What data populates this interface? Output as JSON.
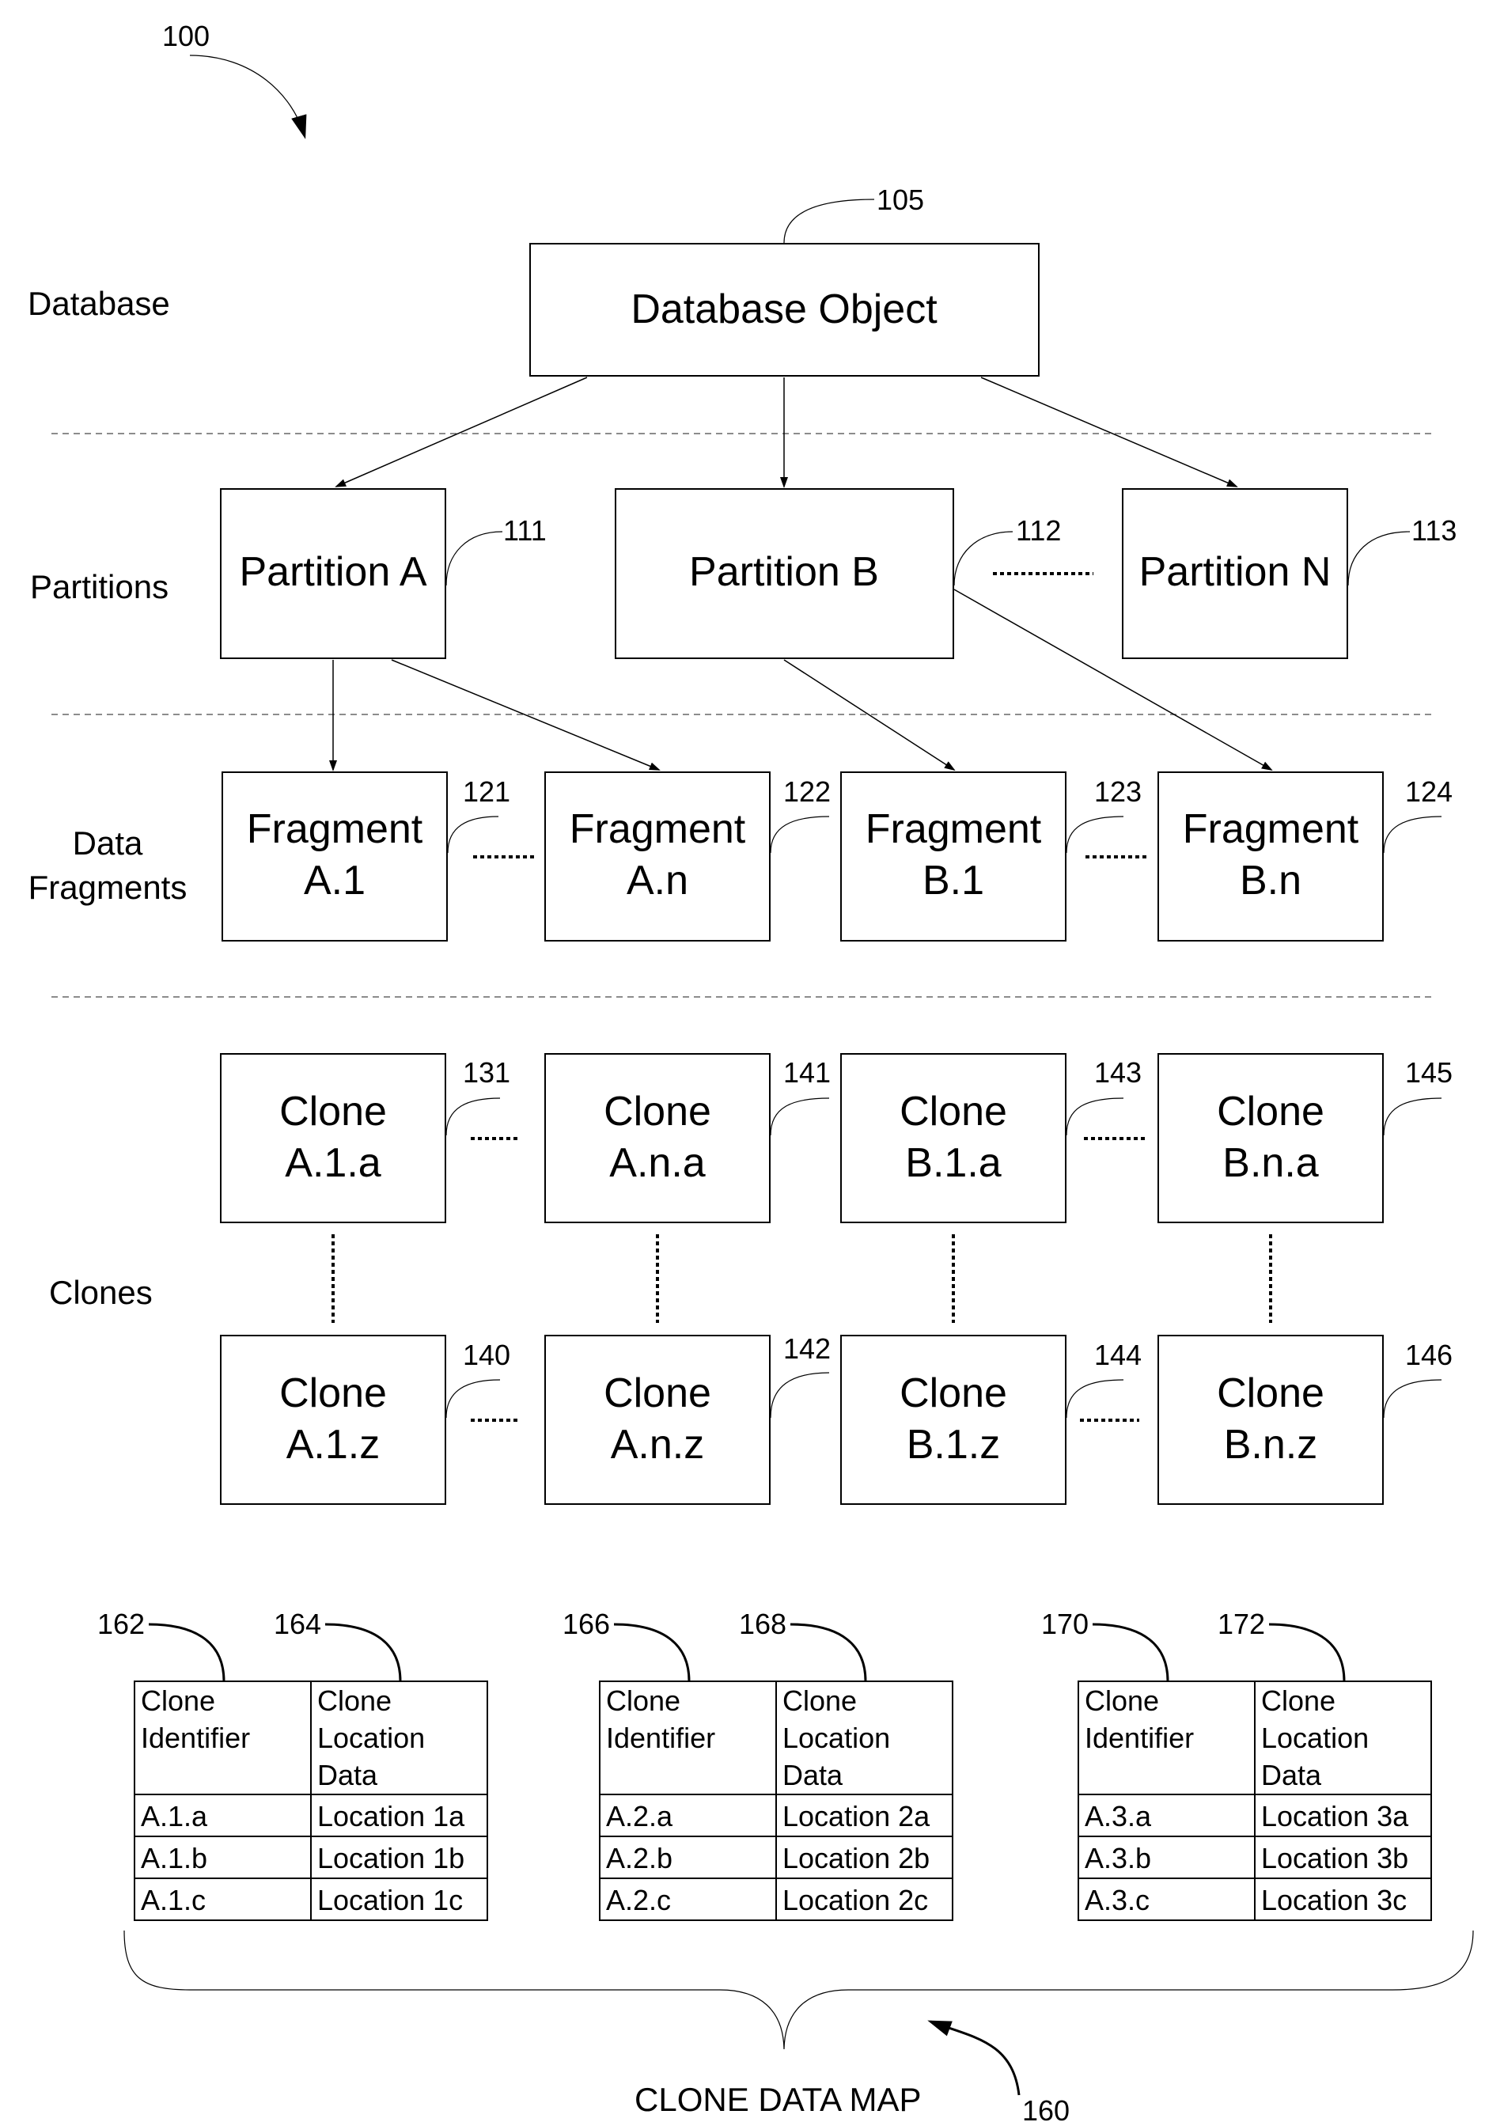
{
  "figure_ref": "100",
  "levels": [
    {
      "label": "Database"
    },
    {
      "label": "Partitions"
    },
    {
      "label_lines": [
        "Data",
        "Fragments"
      ]
    },
    {
      "label": "Clones"
    }
  ],
  "database_object": {
    "label": "Database Object",
    "ref": "105"
  },
  "partitions": [
    {
      "label": "Partition A",
      "ref": "111"
    },
    {
      "label": "Partition B",
      "ref": "112"
    },
    {
      "label": "Partition N",
      "ref": "113"
    }
  ],
  "fragments": [
    {
      "lines": [
        "Fragment",
        "A.1"
      ],
      "ref": "121"
    },
    {
      "lines": [
        "Fragment",
        "A.n"
      ],
      "ref": "122"
    },
    {
      "lines": [
        "Fragment",
        "B.1"
      ],
      "ref": "123"
    },
    {
      "lines": [
        "Fragment",
        "B.n"
      ],
      "ref": "124"
    }
  ],
  "clones_top": [
    {
      "lines": [
        "Clone",
        "A.1.a"
      ],
      "ref": "131"
    },
    {
      "lines": [
        "Clone",
        "A.n.a"
      ],
      "ref": "141"
    },
    {
      "lines": [
        "Clone",
        "B.1.a"
      ],
      "ref": "143"
    },
    {
      "lines": [
        "Clone",
        "B.n.a"
      ],
      "ref": "145"
    }
  ],
  "clones_bottom": [
    {
      "lines": [
        "Clone",
        "A.1.z"
      ],
      "ref": "140"
    },
    {
      "lines": [
        "Clone",
        "A.n.z"
      ],
      "ref": "142"
    },
    {
      "lines": [
        "Clone",
        "B.1.z"
      ],
      "ref": "144"
    },
    {
      "lines": [
        "Clone",
        "B.n.z"
      ],
      "ref": "146"
    }
  ],
  "tables": [
    {
      "refs": [
        "162",
        "164"
      ],
      "headers": [
        [
          "Clone",
          "Identifier"
        ],
        [
          "Clone",
          "Location",
          "Data"
        ]
      ],
      "rows": [
        [
          "A.1.a",
          "Location 1a"
        ],
        [
          "A.1.b",
          "Location 1b"
        ],
        [
          "A.1.c",
          "Location 1c"
        ]
      ]
    },
    {
      "refs": [
        "166",
        "168"
      ],
      "headers": [
        [
          "Clone",
          "Identifier"
        ],
        [
          "Clone",
          "Location",
          "Data"
        ]
      ],
      "rows": [
        [
          "A.2.a",
          "Location 2a"
        ],
        [
          "A.2.b",
          "Location 2b"
        ],
        [
          "A.2.c",
          "Location 2c"
        ]
      ]
    },
    {
      "refs": [
        "170",
        "172"
      ],
      "headers": [
        [
          "Clone",
          "Identifier"
        ],
        [
          "Clone",
          "Location",
          "Data"
        ]
      ],
      "rows": [
        [
          "A.3.a",
          "Location 3a"
        ],
        [
          "A.3.b",
          "Location 3b"
        ],
        [
          "A.3.c",
          "Location 3c"
        ]
      ]
    }
  ],
  "clone_data_map": {
    "label": "CLONE DATA MAP",
    "ref": "160"
  }
}
